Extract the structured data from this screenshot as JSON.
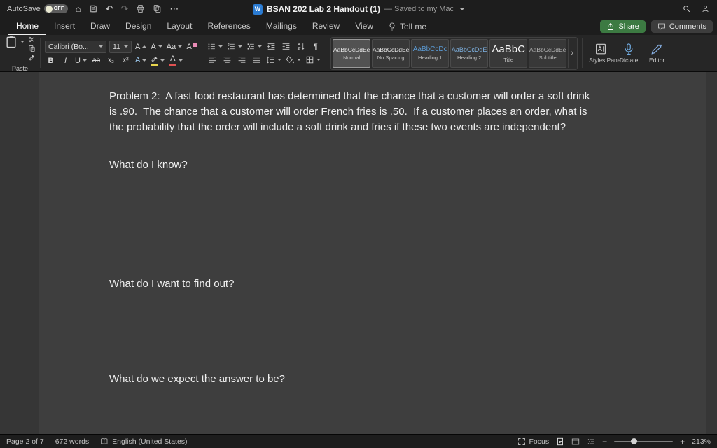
{
  "colors": {
    "share_button_green": "#3c7a42",
    "word_icon_blue": "#2b7cd3",
    "heading_style_blue": "#5b9bd5",
    "highlight_yellow": "#e8d44d",
    "font_color_red": "#e05252"
  },
  "titlebar": {
    "autosave_label": "AutoSave",
    "autosave_state": "OFF",
    "doc_title": "BSAN 202 Lab 2 Handout (1)",
    "saved_status": "— Saved to my Mac"
  },
  "icons": {
    "word_badge": "W",
    "home": "⌂",
    "undo": "↶",
    "redo": "↷",
    "more": "⋯",
    "paragraph_mark": "¶",
    "gallery_more": "›"
  },
  "tabs": {
    "items": [
      {
        "label": "Home"
      },
      {
        "label": "Insert"
      },
      {
        "label": "Draw"
      },
      {
        "label": "Design"
      },
      {
        "label": "Layout"
      },
      {
        "label": "References"
      },
      {
        "label": "Mailings"
      },
      {
        "label": "Review"
      },
      {
        "label": "View"
      }
    ],
    "tell_me_label": "Tell me",
    "share_label": "Share",
    "comments_label": "Comments"
  },
  "ribbon": {
    "paste_label": "Paste",
    "font": {
      "name": "Calibri (Bo...",
      "size": "11",
      "grow": "A",
      "shrink": "A",
      "case_label": "Aa",
      "clear_label": "A",
      "bold": "B",
      "italic": "I",
      "underline": "U",
      "strike": "ab",
      "subscript": "x₂",
      "superscript": "x²",
      "effects": "A",
      "color": "A"
    },
    "styles": [
      {
        "sample": "AaBbCcDdEe",
        "name": "Normal"
      },
      {
        "sample": "AaBbCcDdEe",
        "name": "No Spacing"
      },
      {
        "sample": "AaBbCcDc",
        "name": "Heading 1"
      },
      {
        "sample": "AaBbCcDdE",
        "name": "Heading 2"
      },
      {
        "sample": "AaBbC",
        "name": "Title"
      },
      {
        "sample": "AaBbCcDdEe",
        "name": "Subtitle"
      }
    ],
    "styles_pane_label": "Styles Pane",
    "dictate_label": "Dictate",
    "editor_label": "Editor"
  },
  "document": {
    "paragraphs": [
      "Problem 2:  A fast food restaurant has determined that the chance that a customer will order a soft drink is .90.  The chance that a customer will order French fries is .50.  If a customer places an order, what is the probability that the order will include a soft drink and fries if these two events are independent?",
      "What do I know?",
      "What do I want to find out?",
      "What do we expect the answer to be?"
    ]
  },
  "statusbar": {
    "page_info": "Page 2 of 7",
    "word_count": "672 words",
    "language": "English (United States)",
    "focus_label": "Focus",
    "zoom_level": "213%",
    "zoom_out": "−",
    "zoom_in": "+"
  }
}
